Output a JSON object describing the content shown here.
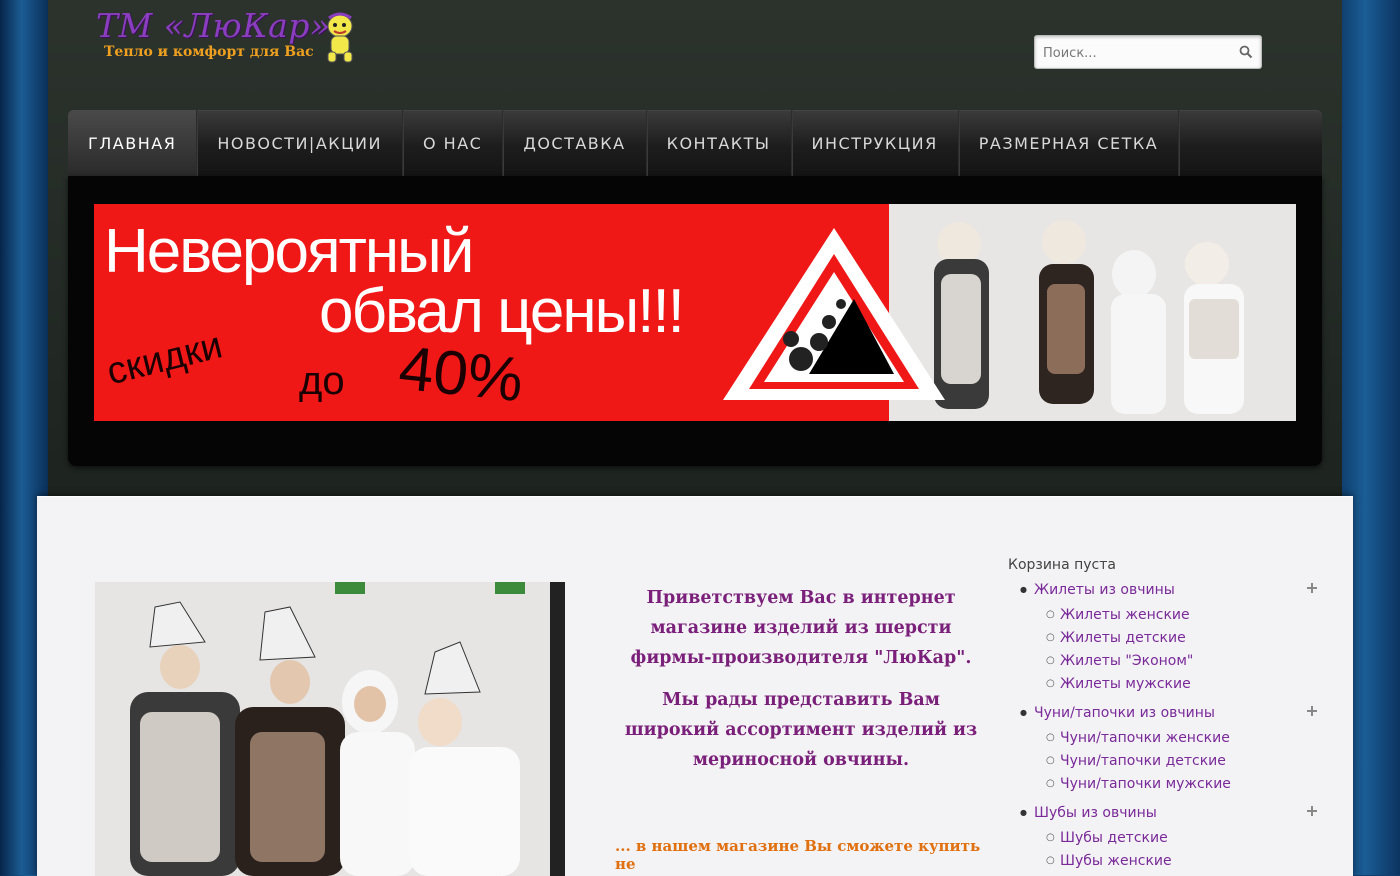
{
  "brand": {
    "logo_text": "ТМ «ЛюКар»",
    "tagline": "Тепло и комфорт для Вас"
  },
  "search": {
    "placeholder": "Поиск..."
  },
  "nav": {
    "items": [
      {
        "label": "ГЛАВНАЯ"
      },
      {
        "label": "НОВОСТИ|АКЦИИ"
      },
      {
        "label": "О НАС"
      },
      {
        "label": "ДОСТАВКА"
      },
      {
        "label": "КОНТАКТЫ"
      },
      {
        "label": "ИНСТРУКЦИЯ"
      },
      {
        "label": "РАЗМЕРНАЯ СЕТКА"
      }
    ]
  },
  "banner": {
    "line1": "Невероятный",
    "line2": "обвал  цены!!!",
    "sale": "скидки",
    "upto": "до",
    "percent": "40%"
  },
  "welcome": {
    "p1": "Приветствуем Вас в интернет магазине изделий из шерсти фирмы-производителя \"ЛюКар\".",
    "p2": "Мы рады представить Вам широкий ассортимент изделий из мериносной овчины.",
    "promo": "... в нашем магазине Вы сможете купить не"
  },
  "sidebar": {
    "cart": "Корзина пуста",
    "categories": [
      {
        "label": "Жилеты из овчины",
        "subs": [
          "Жилеты женские",
          "Жилеты детские",
          "Жилеты \"Эконом\"",
          "Жилеты мужские"
        ]
      },
      {
        "label": "Чуни/тапочки из овчины",
        "subs": [
          "Чуни/тапочки женские",
          "Чуни/тапочки детские",
          "Чуни/тапочки мужские"
        ]
      },
      {
        "label": "Шубы из овчины",
        "subs": [
          "Шубы детские",
          "Шубы женские"
        ]
      }
    ]
  },
  "colors": {
    "accent_purple": "#7a1f7a",
    "banner_red": "#f01717",
    "promo_orange": "#e07010"
  }
}
